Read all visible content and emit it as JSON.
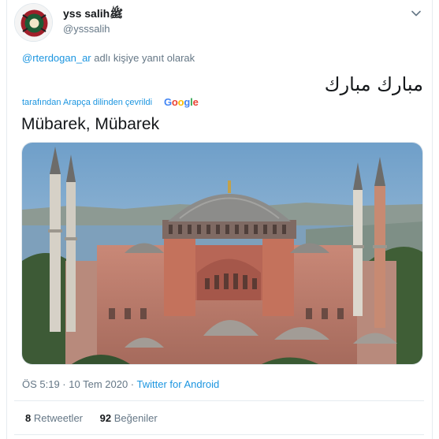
{
  "tweet": {
    "display_name": "yss salihﷺ",
    "handle": "@ysssalih",
    "reply_mention": "@rterdogan_ar",
    "reply_suffix": " adlı kişiye yanıt olarak",
    "text": "مبارك مبارك",
    "translated_label": "tarafından Arapça dilinden çevrildi",
    "translation_provider": "Google",
    "translation": "Mübarek, Mübarek",
    "time": "ÖS 5:19 · 10 Tem 2020",
    "separator": " · ",
    "source": "Twitter for Android",
    "retweets_count": "8",
    "retweets_label": "Retweetler",
    "likes_count": "92",
    "likes_label": "Beğeniler"
  },
  "icons": {
    "caret": "chevron-down-icon"
  },
  "colors": {
    "link": "#1b95e0",
    "secondary_text": "#657786",
    "primary_text": "#14171a",
    "divider": "#e6ecf0"
  }
}
